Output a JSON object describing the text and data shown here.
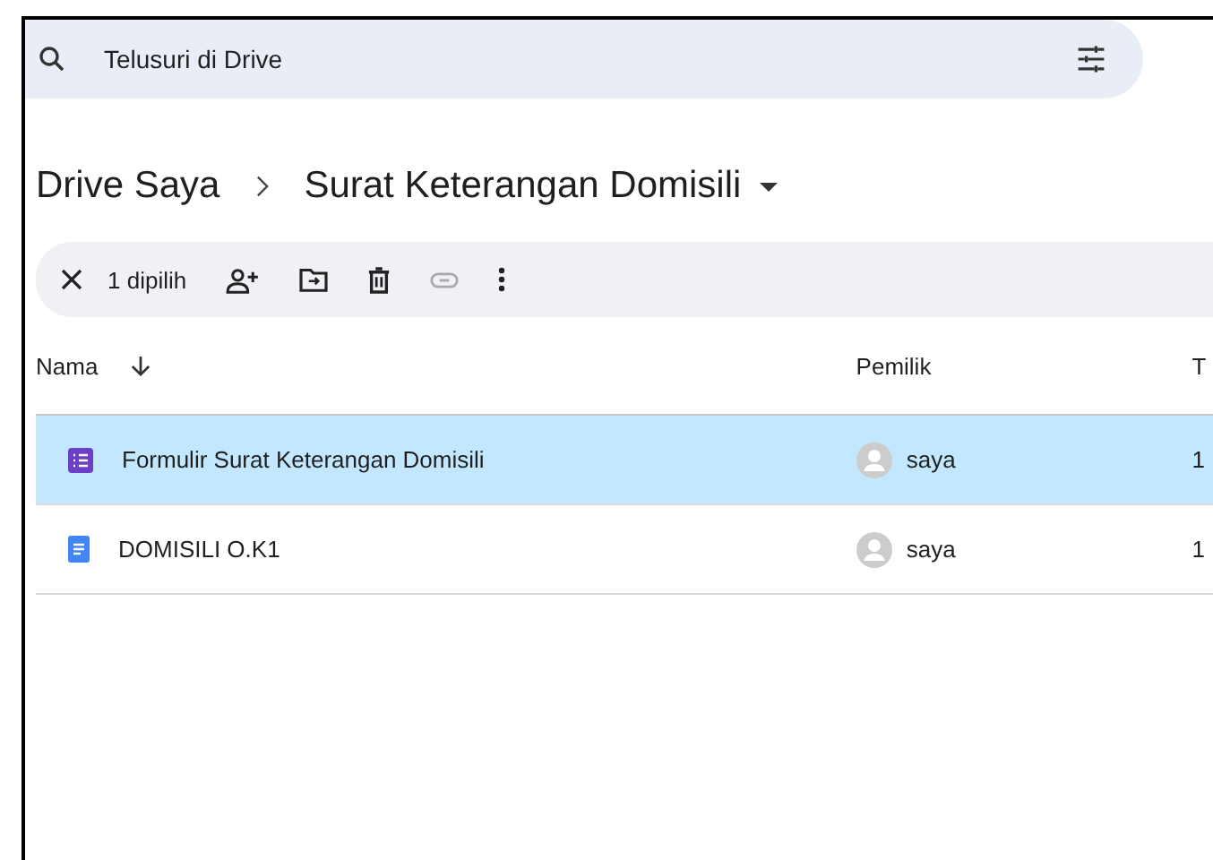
{
  "search": {
    "placeholder": "Telusuri di Drive"
  },
  "breadcrumb": [
    {
      "label": "Drive Saya"
    },
    {
      "label": "Surat Keterangan Domisili"
    }
  ],
  "selection_bar": {
    "count": "1 dipilih",
    "link_disabled": true
  },
  "table": {
    "columns": [
      {
        "label": "Nama",
        "sorted": true
      },
      {
        "label": "Pemilik"
      },
      {
        "label": "T"
      }
    ],
    "rows": [
      {
        "kind": "form",
        "name": "Formulir Surat Keterangan Domisili",
        "owner": "saya",
        "column_3": "1",
        "selected": true
      },
      {
        "kind": "doc",
        "name": "DOMISILI O.K1",
        "owner": "saya",
        "column_3": "1",
        "selected": false
      }
    ]
  }
}
